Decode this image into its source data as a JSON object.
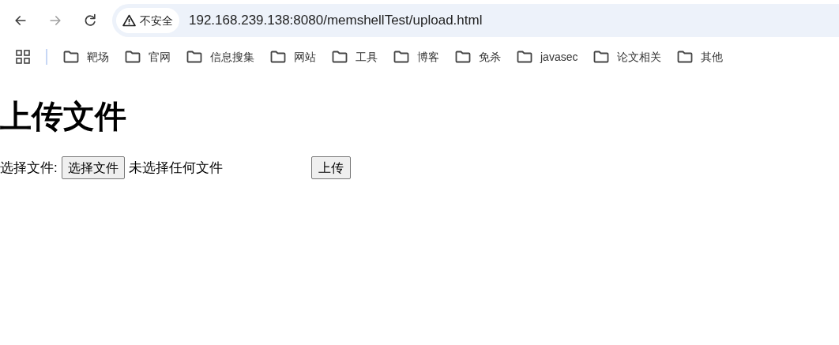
{
  "toolbar": {
    "nav_buttons": [
      {
        "kind": "back",
        "disabled": false
      },
      {
        "kind": "forward",
        "disabled": true
      },
      {
        "kind": "reload",
        "disabled": false
      }
    ],
    "security_chip": "不安全",
    "url": "192.168.239.138:8080/memshellTest/upload.html"
  },
  "bookmarks": [
    "靶场",
    "官网",
    "信息搜集",
    "网站",
    "工具",
    "博客",
    "免杀",
    "javasec",
    "论文相关",
    "其他"
  ],
  "page": {
    "heading": "上传文件",
    "field_label": "选择文件:",
    "file_button": "选择文件",
    "file_status": "未选择任何文件",
    "submit_button": "上传"
  }
}
